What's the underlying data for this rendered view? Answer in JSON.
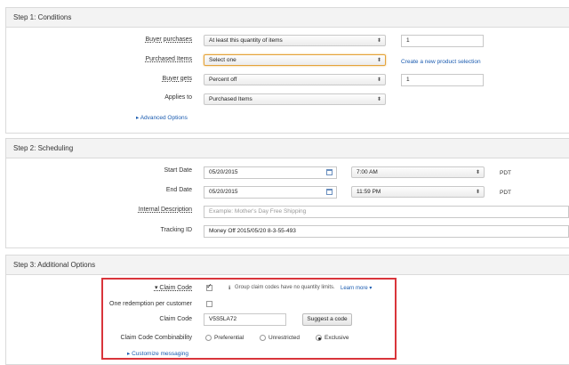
{
  "step1": {
    "title": "Step 1: Conditions",
    "buyer_purchases_label": "Buyer purchases",
    "buyer_purchases_value": "At least this quantity of items",
    "buyer_purchases_qty": "1",
    "purchased_items_label": "Purchased Items",
    "purchased_items_value": "Select one",
    "create_selection_link": "Create a new product selection",
    "buyer_gets_label": "Buyer gets",
    "buyer_gets_value": "Percent off",
    "buyer_gets_qty": "1",
    "applies_to_label": "Applies to",
    "applies_to_value": "Purchased Items",
    "advanced_options": "Advanced Options"
  },
  "step2": {
    "title": "Step 2: Scheduling",
    "start_date_label": "Start Date",
    "start_date_value": "05/20/2015",
    "start_time_value": "7:00 AM",
    "start_tz": "PDT",
    "end_date_label": "End Date",
    "end_date_value": "05/20/2015",
    "end_time_value": "11:59 PM",
    "end_tz": "PDT",
    "internal_desc_label": "Internal Description",
    "internal_desc_placeholder": "Example: Mother's Day Free Shipping",
    "tracking_id_label": "Tracking ID",
    "tracking_id_value": "Money Off 2015/05/20 8-3-55-493"
  },
  "step3": {
    "title": "Step 3: Additional Options",
    "claim_code_toggle_label": "Claim Code",
    "claim_code_checked": true,
    "claim_code_note": "Group claim codes have no quantity limits.",
    "learn_more": "Learn more",
    "one_redemption_label": "One redemption per customer",
    "one_redemption_checked": false,
    "claim_code_label": "Claim Code",
    "claim_code_value": "V5S5LA72",
    "suggest_code_button": "Suggest a code",
    "combinability_label": "Claim Code Combinability",
    "combinability_options": [
      "Preferential",
      "Unrestricted",
      "Exclusive"
    ],
    "combinability_selected": "Exclusive",
    "customize_messaging": "Customize messaging"
  },
  "colors": {
    "link": "#1a5bb0",
    "highlight_border": "#d9353b",
    "focus_border": "#e4a33a"
  }
}
